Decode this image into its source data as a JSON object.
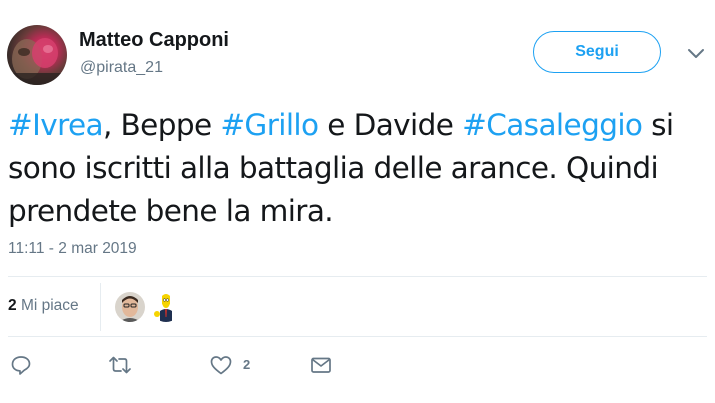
{
  "author": {
    "name": "Matteo Capponi",
    "handle": "@pirata_21"
  },
  "follow_button": {
    "label": "Segui"
  },
  "tweet": {
    "segments": [
      {
        "text": "#Ivrea",
        "hashtag": true
      },
      {
        "text": ", Beppe ",
        "hashtag": false
      },
      {
        "text": "#Grillo",
        "hashtag": true
      },
      {
        "text": " e Davide ",
        "hashtag": false
      },
      {
        "text": "#Casaleggio",
        "hashtag": true
      },
      {
        "text": " si sono iscritti alla battaglia delle arance. Quindi prendete bene la mira.",
        "hashtag": false
      }
    ],
    "timestamp": "11:11 - 2 mar 2019"
  },
  "likes": {
    "count": "2",
    "label": "Mi piace"
  },
  "actions": {
    "like_count": "2"
  },
  "icons": {
    "reply": "reply-icon",
    "retweet": "retweet-icon",
    "like": "heart-icon",
    "dm": "envelope-icon",
    "more": "chevron-down-icon"
  },
  "colors": {
    "accent": "#1da1f2",
    "secondary_text": "#657786",
    "primary_text": "#14171a",
    "divider": "#e6ecf0"
  }
}
